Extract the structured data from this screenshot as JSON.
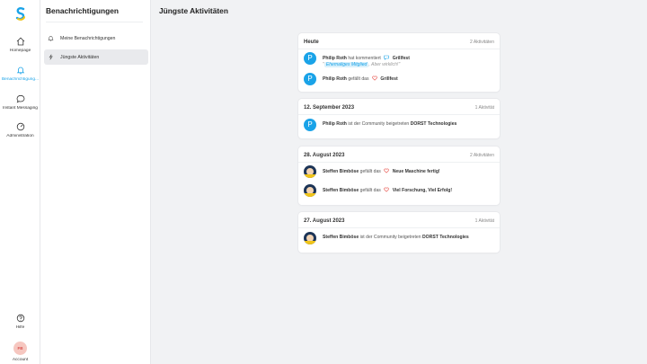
{
  "rail": {
    "items": [
      {
        "label": "Homepage",
        "icon": "home-icon"
      },
      {
        "label": "Benachrichtigung...",
        "icon": "bell-icon"
      },
      {
        "label": "Instant Messaging",
        "icon": "chat-icon"
      },
      {
        "label": "Administration",
        "icon": "gauge-icon"
      }
    ],
    "help_label": "Hilfe",
    "account_label": "Account",
    "account_initials": "FB"
  },
  "panel": {
    "title": "Benachrichtigungen",
    "items": [
      {
        "label": "Meine Benachrichtigungen",
        "icon": "bell-icon"
      },
      {
        "label": "Jüngste Aktivitäten",
        "icon": "activity-icon"
      }
    ]
  },
  "main": {
    "title": "Jüngste Aktivitäten",
    "groups": [
      {
        "date": "Heute",
        "count": "2 Aktivitäten",
        "activities": [
          {
            "avatar": "P",
            "actor": "Philip Roth",
            "verb": "hat kommentiert",
            "object": "Grillfest",
            "quote_open": "\"",
            "quote_tag": "Ehemaliges Mitglied",
            "quote_rest": ", Aber wirklich!\""
          },
          {
            "avatar": "P",
            "actor": "Philip Roth",
            "verb": "gefällt das",
            "object": "Grillfest"
          }
        ]
      },
      {
        "date": "12. September 2023",
        "count": "1 Aktivität",
        "activities": [
          {
            "avatar": "P",
            "actor": "Philip Roth",
            "verb": "ist der Community beigetreten",
            "object": "DORST Technologies"
          }
        ]
      },
      {
        "date": "28. August 2023",
        "count": "2 Aktivitäten",
        "activities": [
          {
            "actor": "Steffen Bimböse",
            "verb": "gefällt das",
            "object": "Neue Maschine fertig!"
          },
          {
            "actor": "Steffen Bimböse",
            "verb": "gefällt das",
            "object": "Viel Forschung, Viel Erfolg!"
          }
        ]
      },
      {
        "date": "27. August 2023",
        "count": "1 Aktivität",
        "activities": [
          {
            "actor": "Steffen Bimböse",
            "verb": "ist der Community beigetreten",
            "object": "DORST Technologies"
          }
        ]
      }
    ]
  },
  "colors": {
    "accent": "#1aa3e8",
    "heart": "#e8554e",
    "background": "#f1f2f4"
  }
}
